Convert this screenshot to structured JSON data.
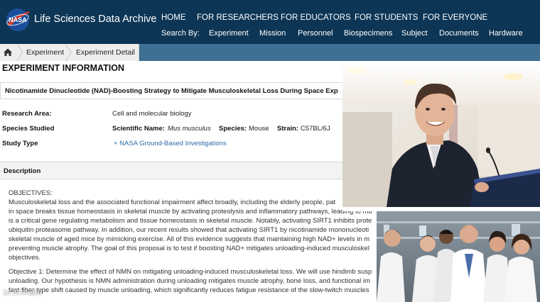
{
  "site": {
    "title": "Life Sciences Data Archive",
    "logo_text": "NASA"
  },
  "top_nav": [
    "HOME",
    "FOR RESEARCHERS",
    "FOR EDUCATORS",
    "FOR STUDENTS",
    "FOR EVERYONE"
  ],
  "search_by": {
    "label": "Search By:",
    "items": [
      "Experiment",
      "Mission",
      "Personnel",
      "Biospecimens",
      "Subject",
      "Documents",
      "Hardware"
    ]
  },
  "breadcrumb": {
    "items": [
      "Experiment",
      "Experiment Detail"
    ]
  },
  "page": {
    "heading": "EXPERIMENT INFORMATION",
    "experiment_title": "Nicotinamide Dinucleotide (NAD)-Boosting Strategy to Mitigate Musculoskeletal Loss During Space Exp"
  },
  "fields": {
    "research_area_label": "Research Area:",
    "research_area_value": "Cell and molecular biology",
    "species_label": "Species Studied",
    "scientific_name_label": "Scientific Name:",
    "scientific_name_value": "Mus musculus",
    "species_field_label": "Species:",
    "species_value": "Mouse",
    "strain_label": "Strain:",
    "strain_value": "C57BL/6J",
    "study_type_label": "Study Type",
    "study_type_value": "+ NASA Ground-Based Investigations"
  },
  "description": {
    "title": "Description",
    "lines": [
      "OBJECTIVES:",
      "Musculoskeletal loss and the associated functional impairment affect broadly, including the elderly people, pat",
      "in space breaks tissue homeostasis in skeletal muscle by activating proteolysis and inflammatory pathways, leading to mu",
      "is a critical gene regulating metabolism and tissue homeostasis in skeletal muscle. Notably, activating SIRT1 inhibits prote",
      "ubiquitin proteasome pathway. In addition, our recent results showed that activating SIRT1 by nicotinamide mononucleoti",
      "skeletal muscle of aged mice by mimicking exercise. All of this evidence suggests that maintaining high NAD+ levels in m",
      "preventing muscle atrophy. The goal of this proposal is to test if boosting NAD+ mitigates unloading-induced musculoskel",
      "objectives.",
      "Objective 1: Determine the effect of NMN on mitigating unloading-induced musculoskeletal loss. We will use hindimb susp",
      "unloading. Our hypothesis is NMN administration during unloading mitigates muscle atrophy, bone loss, and functional im",
      "fast fiber type shift caused by muscle unloading, which significantly reduces fatigue resistance of the slow-twitch muscles"
    ]
  },
  "watermark": "10 iNTA道的"
}
